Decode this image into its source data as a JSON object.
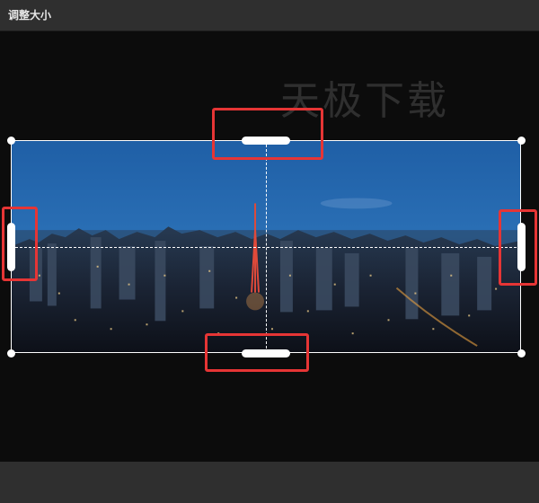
{
  "window": {
    "title": "调整大小"
  },
  "canvas": {
    "watermark": "天极下载"
  },
  "colors": {
    "title_bar": "#2f2f2f",
    "canvas_bg": "#0c0c0c",
    "crop_border": "#ffffff",
    "highlight": "#e63535"
  },
  "crop": {
    "handles": [
      "top-handle",
      "bottom-handle",
      "left-handle",
      "right-handle"
    ],
    "corners": [
      "top-left",
      "top-right",
      "bottom-left",
      "bottom-right"
    ],
    "highlighted_handles": [
      "top",
      "bottom",
      "left",
      "right"
    ]
  },
  "image": {
    "subject": "city-skyline-night-photo"
  }
}
